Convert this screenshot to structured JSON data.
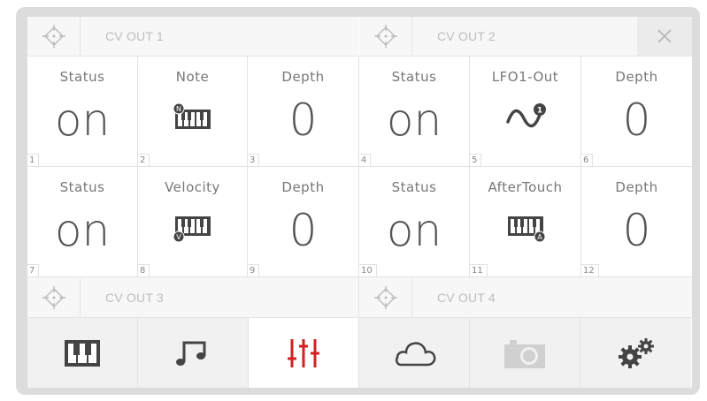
{
  "headers": {
    "cv_out_1": "CV OUT 1",
    "cv_out_2": "CV OUT 2",
    "cv_out_3": "CV OUT 3",
    "cv_out_4": "CV OUT 4"
  },
  "cells": [
    {
      "label": "Status",
      "value": "on",
      "num": "1"
    },
    {
      "label": "Note",
      "value": "",
      "num": "2",
      "icon": "keyboard-note-icon"
    },
    {
      "label": "Depth",
      "value": "0",
      "num": "3"
    },
    {
      "label": "Status",
      "value": "on",
      "num": "4"
    },
    {
      "label": "LFO1-Out",
      "value": "",
      "num": "5",
      "icon": "sine-wave-lfo1-icon"
    },
    {
      "label": "Depth",
      "value": "0",
      "num": "6"
    },
    {
      "label": "Status",
      "value": "on",
      "num": "7"
    },
    {
      "label": "Velocity",
      "value": "",
      "num": "8",
      "icon": "keyboard-velocity-icon"
    },
    {
      "label": "Depth",
      "value": "0",
      "num": "9"
    },
    {
      "label": "Status",
      "value": "on",
      "num": "10"
    },
    {
      "label": "AfterTouch",
      "value": "",
      "num": "11",
      "icon": "keyboard-aftertouch-icon"
    },
    {
      "label": "Depth",
      "value": "0",
      "num": "12"
    }
  ],
  "nav": [
    {
      "icon": "piano-keys-icon",
      "active": false
    },
    {
      "icon": "music-notes-icon",
      "active": false
    },
    {
      "icon": "mixer-sliders-icon",
      "active": true
    },
    {
      "icon": "cloud-icon",
      "active": false
    },
    {
      "icon": "camera-icon",
      "active": false
    },
    {
      "icon": "gears-icon",
      "active": false
    }
  ],
  "colors": {
    "accent": "#d32020",
    "icon_dark": "#444444",
    "disabled": "#cccccc"
  }
}
